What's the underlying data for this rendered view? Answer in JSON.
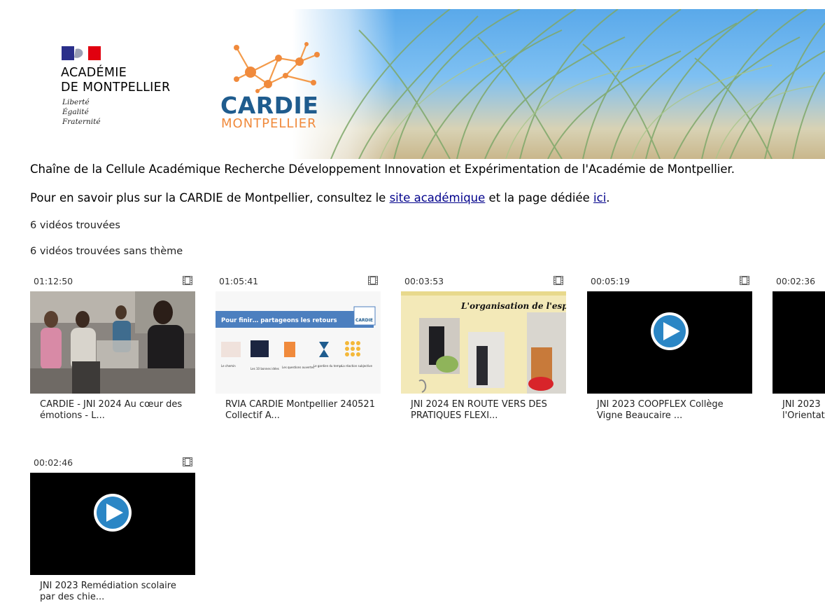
{
  "banner": {
    "institution_lines": [
      "ACADÉMIE",
      "DE MONTPELLIER"
    ],
    "motto_lines": [
      "Liberté",
      "Égalité",
      "Fraternité"
    ],
    "cardie_title": "CARDIE",
    "cardie_subtitle": "MONTPELLIER"
  },
  "description": "Chaîne de la Cellule Académique Recherche Développement Innovation et Expérimentation de l'Académie de Montpellier.",
  "info": {
    "prefix": "Pour en savoir plus sur la CARDIE de Montpellier, consultez le ",
    "link1": "site académique",
    "middle": " et la page dédiée ",
    "link2": "ici",
    "suffix": "."
  },
  "counts": {
    "total": "6 vidéos trouvées",
    "no_theme": "6 vidéos trouvées sans thème"
  },
  "videos": [
    {
      "duration": "01:12:50",
      "title": "CARDIE - JNI 2024 Au cœur des émotions - L...",
      "thumb": "photo-audience"
    },
    {
      "duration": "01:05:41",
      "title": "RVIA CARDIE Montpellier 240521 Collectif A...",
      "thumb": "slide"
    },
    {
      "duration": "00:03:53",
      "title": "JNI 2024 EN ROUTE VERS DES PRATIQUES FLEXI...",
      "thumb": "poster"
    },
    {
      "duration": "00:05:19",
      "title": "JNI 2023 COOPFLEX Collège Vigne Beaucaire ...",
      "thumb": "play-icon"
    },
    {
      "duration": "00:02:36",
      "title": "JNI 2023 l'Orientat",
      "thumb": "black"
    },
    {
      "duration": "00:02:46",
      "title": "JNI 2023 Remédiation scolaire par des chie...",
      "thumb": "play-icon"
    }
  ],
  "slide": {
    "heading": "Pour finir… partageons les retours",
    "labels": [
      "Le chemin",
      "Les 10 bonnes idées",
      "Les questions ouvertes",
      "Le gardien du temps",
      "La réaction subjective"
    ]
  },
  "poster_heading": "L'organisation de l'espa",
  "colors": {
    "link": "#00008b",
    "cardie_blue": "#1f5c8e",
    "cardie_orange": "#f08a3c",
    "play_blue": "#2b86c5"
  }
}
